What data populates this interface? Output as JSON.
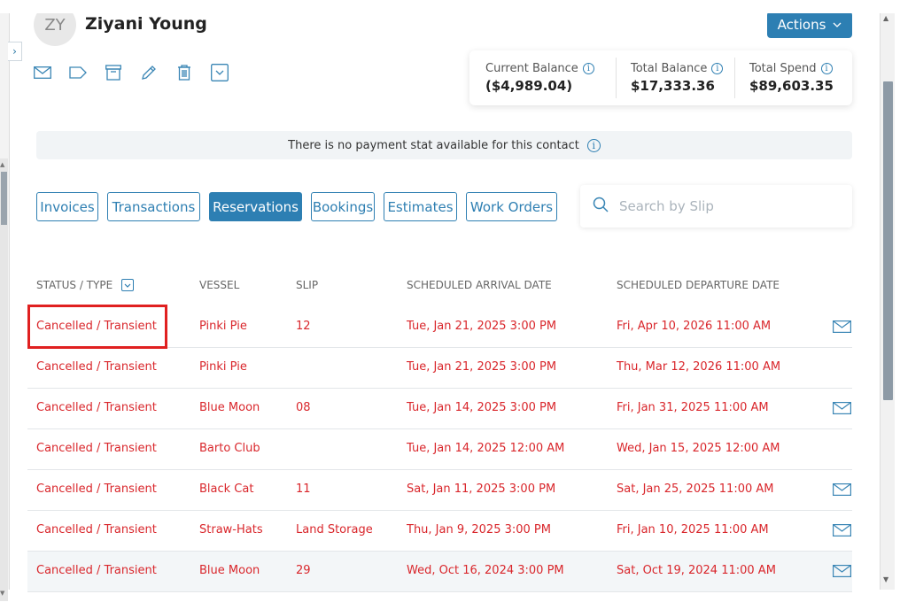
{
  "contact": {
    "initials": "ZY",
    "name": "Ziyani Young"
  },
  "header": {
    "actions_label": "Actions"
  },
  "toolbar": {
    "icons": [
      "mail-icon",
      "tag-icon",
      "archive-icon",
      "pencil-icon",
      "trash-icon",
      "dropdown-icon"
    ]
  },
  "balances": {
    "current_label": "Current Balance",
    "current_value": "($4,989.04)",
    "total_label": "Total Balance",
    "total_value": "$17,333.36",
    "spend_label": "Total Spend",
    "spend_value": "$89,603.35"
  },
  "notice": {
    "text": "There is no payment stat available for this contact"
  },
  "tabs": [
    {
      "label": "Invoices",
      "active": false
    },
    {
      "label": "Transactions",
      "active": false
    },
    {
      "label": "Reservations",
      "active": true
    },
    {
      "label": "Bookings",
      "active": false
    },
    {
      "label": "Estimates",
      "active": false
    },
    {
      "label": "Work Orders",
      "active": false
    }
  ],
  "search": {
    "placeholder": "Search by Slip",
    "value": ""
  },
  "table": {
    "headers": {
      "status": "STATUS / TYPE",
      "vessel": "VESSEL",
      "slip": "SLIP",
      "arrival": "SCHEDULED ARRIVAL DATE",
      "departure": "SCHEDULED DEPARTURE DATE"
    },
    "rows": [
      {
        "status": "Cancelled / Transient",
        "vessel": "Pinki Pie",
        "slip": "12",
        "arrival": "Tue, Jan 21, 2025 3:00 PM",
        "departure": "Fri, Apr 10, 2026 11:00 AM",
        "mail": true
      },
      {
        "status": "Cancelled / Transient",
        "vessel": "Pinki Pie",
        "slip": "",
        "arrival": "Tue, Jan 21, 2025 3:00 PM",
        "departure": "Thu, Mar 12, 2026 11:00 AM",
        "mail": false
      },
      {
        "status": "Cancelled / Transient",
        "vessel": "Blue Moon",
        "slip": "08",
        "arrival": "Tue, Jan 14, 2025 3:00 PM",
        "departure": "Fri, Jan 31, 2025 11:00 AM",
        "mail": true
      },
      {
        "status": "Cancelled / Transient",
        "vessel": "Barto Club",
        "slip": "",
        "arrival": "Tue, Jan 14, 2025 12:00 AM",
        "departure": "Wed, Jan 15, 2025 12:00 AM",
        "mail": false
      },
      {
        "status": "Cancelled / Transient",
        "vessel": "Black Cat",
        "slip": "11",
        "arrival": "Sat, Jan 11, 2025 3:00 PM",
        "departure": "Sat, Jan 25, 2025 11:00 AM",
        "mail": true
      },
      {
        "status": "Cancelled / Transient",
        "vessel": "Straw-Hats",
        "slip": "Land Storage",
        "arrival": "Thu, Jan 9, 2025 3:00 PM",
        "departure": "Fri, Jan 10, 2025 11:00 AM",
        "mail": true
      },
      {
        "status": "Cancelled / Transient",
        "vessel": "Blue Moon",
        "slip": "29",
        "arrival": "Wed, Oct 16, 2024 3:00 PM",
        "departure": "Sat, Oct 19, 2024 11:00 AM",
        "mail": true
      }
    ]
  },
  "colors": {
    "accent": "#2d7fb3",
    "status_cancelled": "#d9262b",
    "highlight": "#e02020"
  }
}
